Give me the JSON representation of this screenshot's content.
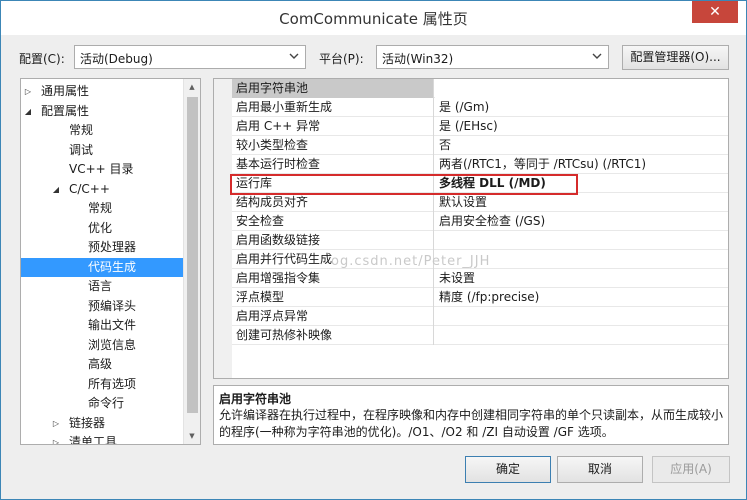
{
  "window": {
    "title": "ComCommunicate 属性页",
    "close_label": "✕"
  },
  "config": {
    "config_label": "配置(C):",
    "config_value": "活动(Debug)",
    "platform_label": "平台(P):",
    "platform_value": "活动(Win32)",
    "manager_label": "配置管理器(O)..."
  },
  "tree": {
    "items": [
      {
        "label": "通用属性",
        "expander": "▷"
      },
      {
        "label": "配置属性",
        "expander": "◢"
      },
      {
        "label": "常规"
      },
      {
        "label": "调试"
      },
      {
        "label": "VC++ 目录"
      },
      {
        "label": "C/C++",
        "expander": "◢"
      },
      {
        "label": "常规"
      },
      {
        "label": "优化"
      },
      {
        "label": "预处理器"
      },
      {
        "label": "代码生成",
        "selected": true
      },
      {
        "label": "语言"
      },
      {
        "label": "预编译头"
      },
      {
        "label": "输出文件"
      },
      {
        "label": "浏览信息"
      },
      {
        "label": "高级"
      },
      {
        "label": "所有选项"
      },
      {
        "label": "命令行"
      },
      {
        "label": "链接器",
        "expander": "▷"
      },
      {
        "label": "清单工具",
        "expander": "▷"
      }
    ]
  },
  "grid": {
    "rows": [
      {
        "name": "启用字符串池",
        "value": ""
      },
      {
        "name": "启用最小重新生成",
        "value": "是 (/Gm)"
      },
      {
        "name": "启用 C++ 异常",
        "value": "是 (/EHsc)"
      },
      {
        "name": "较小类型检查",
        "value": "否"
      },
      {
        "name": "基本运行时检查",
        "value": "两者(/RTC1，等同于 /RTCsu) (/RTC1)"
      },
      {
        "name": "运行库",
        "value": "多线程 DLL (/MD)"
      },
      {
        "name": "结构成员对齐",
        "value": "默认设置"
      },
      {
        "name": "安全检查",
        "value": "启用安全检查 (/GS)"
      },
      {
        "name": "启用函数级链接",
        "value": ""
      },
      {
        "name": "启用并行代码生成",
        "value": ""
      },
      {
        "name": "启用增强指令集",
        "value": "未设置"
      },
      {
        "name": "浮点模型",
        "value": "精度 (/fp:precise)"
      },
      {
        "name": "启用浮点异常",
        "value": ""
      },
      {
        "name": "创建可热修补映像",
        "value": ""
      }
    ],
    "watermark": "og.csdn.net/Peter_JJH"
  },
  "description": {
    "title": "启用字符串池",
    "text": "允许编译器在执行过程中，在程序映像和内存中创建相同字符串的单个只读副本，从而生成较小的程序(一种称为字符串池的优化)。/O1、/O2 和 /ZI 自动设置 /GF 选项。"
  },
  "buttons": {
    "ok": "确定",
    "cancel": "取消",
    "apply": "应用(A)"
  },
  "colors": {
    "selection": "#3399ff",
    "highlight_box": "#d52b2b",
    "close": "#c7463b"
  }
}
